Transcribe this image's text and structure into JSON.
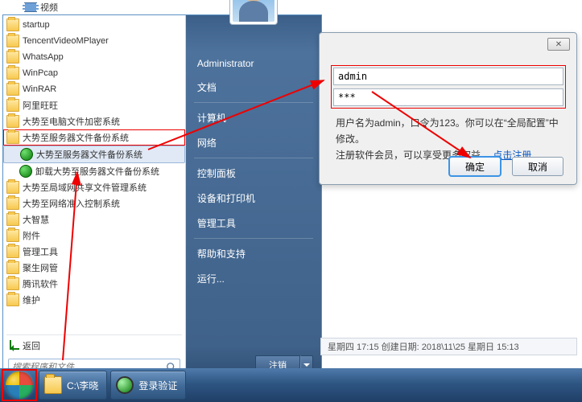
{
  "top_item": "视频",
  "programs": {
    "items": [
      {
        "label": "startup",
        "type": "folder"
      },
      {
        "label": "TencentVideoMPlayer",
        "type": "folder"
      },
      {
        "label": "WhatsApp",
        "type": "folder"
      },
      {
        "label": "WinPcap",
        "type": "folder"
      },
      {
        "label": "WinRAR",
        "type": "folder"
      },
      {
        "label": "阿里旺旺",
        "type": "folder"
      },
      {
        "label": "大势至电脑文件加密系统",
        "type": "folder"
      },
      {
        "label": "大势至服务器文件备份系统",
        "type": "folder",
        "redbox": true
      },
      {
        "label": "大势至服务器文件备份系统",
        "type": "app",
        "indent": true,
        "highlight": true
      },
      {
        "label": "卸载大势至服务器文件备份系统",
        "type": "app",
        "indent": true
      },
      {
        "label": "大势至局域网共享文件管理系统",
        "type": "folder"
      },
      {
        "label": "大势至网络准入控制系统",
        "type": "folder"
      },
      {
        "label": "大智慧",
        "type": "folder"
      },
      {
        "label": "附件",
        "type": "folder"
      },
      {
        "label": "管理工具",
        "type": "folder"
      },
      {
        "label": "聚生网管",
        "type": "folder"
      },
      {
        "label": "腾讯软件",
        "type": "folder"
      },
      {
        "label": "维护",
        "type": "folder"
      }
    ],
    "back_label": "返回"
  },
  "search": {
    "placeholder": "搜索程序和文件"
  },
  "right_panel": {
    "user": "Administrator",
    "items": [
      "文档",
      "计算机",
      "网络",
      "控制面板",
      "设备和打印机",
      "管理工具",
      "帮助和支持",
      "运行..."
    ],
    "shutdown": "注销"
  },
  "dialog": {
    "username": "admin",
    "password": "***",
    "msg_prefix": "用户名为admin，口令为123。你可以在“全局配置”中修改。",
    "msg_line2_prefix": "注册软件会员，可以享受更多权益。",
    "link": "点击注册",
    "ok": "确定",
    "cancel": "取消",
    "close": "✕"
  },
  "status": "星期四 17:15 创建日期: 2018\\11\\25 星期日 15:13",
  "taskbar": {
    "btn1": "C:\\李晓",
    "btn2": "登录验证"
  }
}
